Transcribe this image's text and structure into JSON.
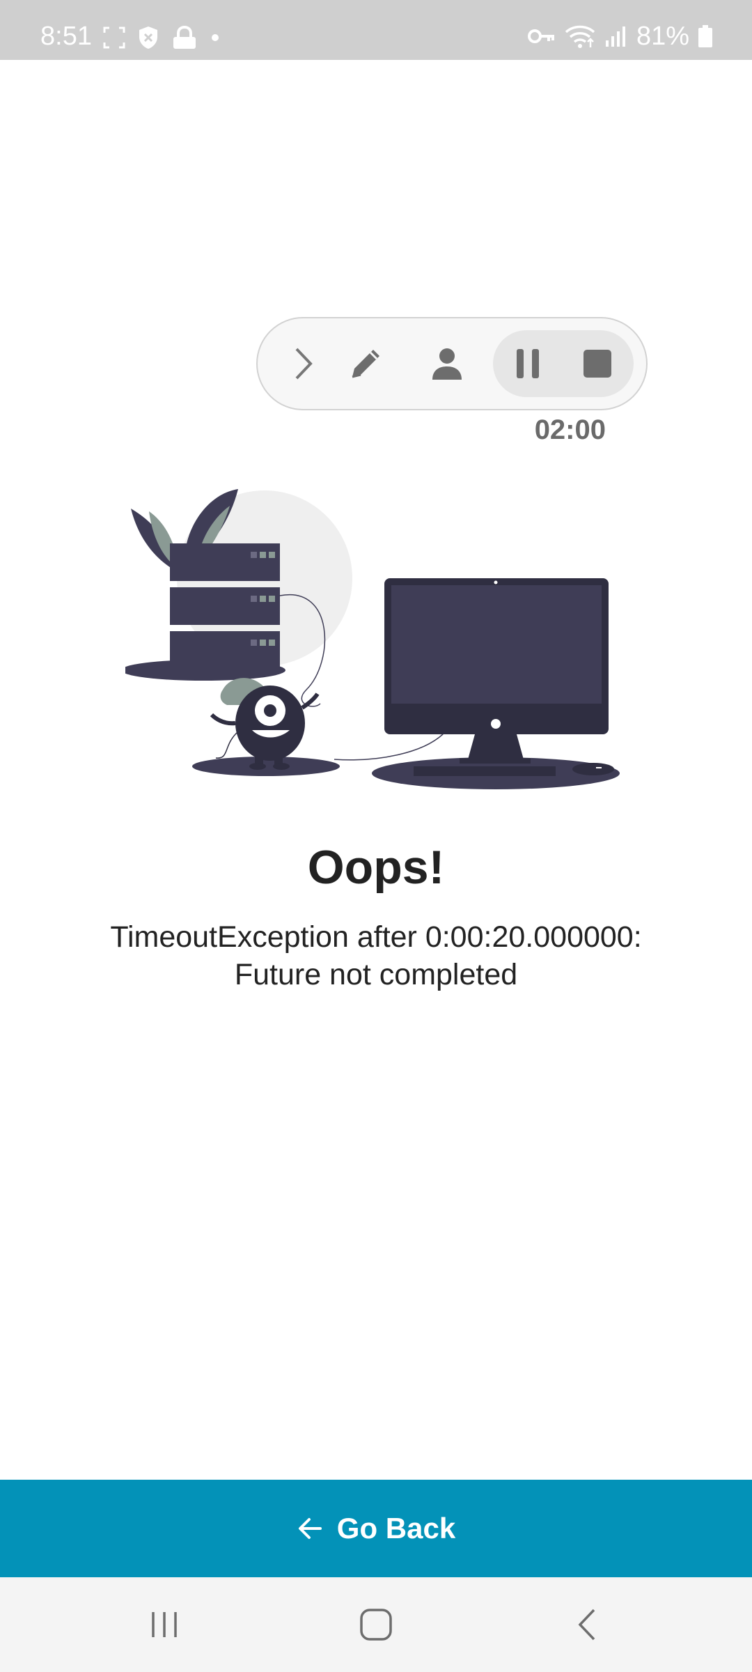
{
  "status_bar": {
    "time": "8:51",
    "battery": "81%",
    "left_icons": [
      "screenshot-icon",
      "shield-icon",
      "lock-icon",
      "dot-icon"
    ],
    "right_icons": [
      "key-icon",
      "wifi-icon",
      "signal-icon",
      "battery-icon"
    ]
  },
  "recorder": {
    "buttons": [
      "chevron-right-icon",
      "pencil-icon",
      "person-icon",
      "pause-icon",
      "stop-icon"
    ],
    "timer": "02:00"
  },
  "illustration": {
    "name": "server-down-illustration"
  },
  "error": {
    "title": "Oops!",
    "message": "TimeoutException after 0:00:20.000000: Future not completed"
  },
  "go_back": {
    "label": "Go Back",
    "color": "#0392b8"
  },
  "nav_bar": {
    "buttons": [
      "recent-apps-icon",
      "home-icon",
      "back-icon"
    ]
  }
}
